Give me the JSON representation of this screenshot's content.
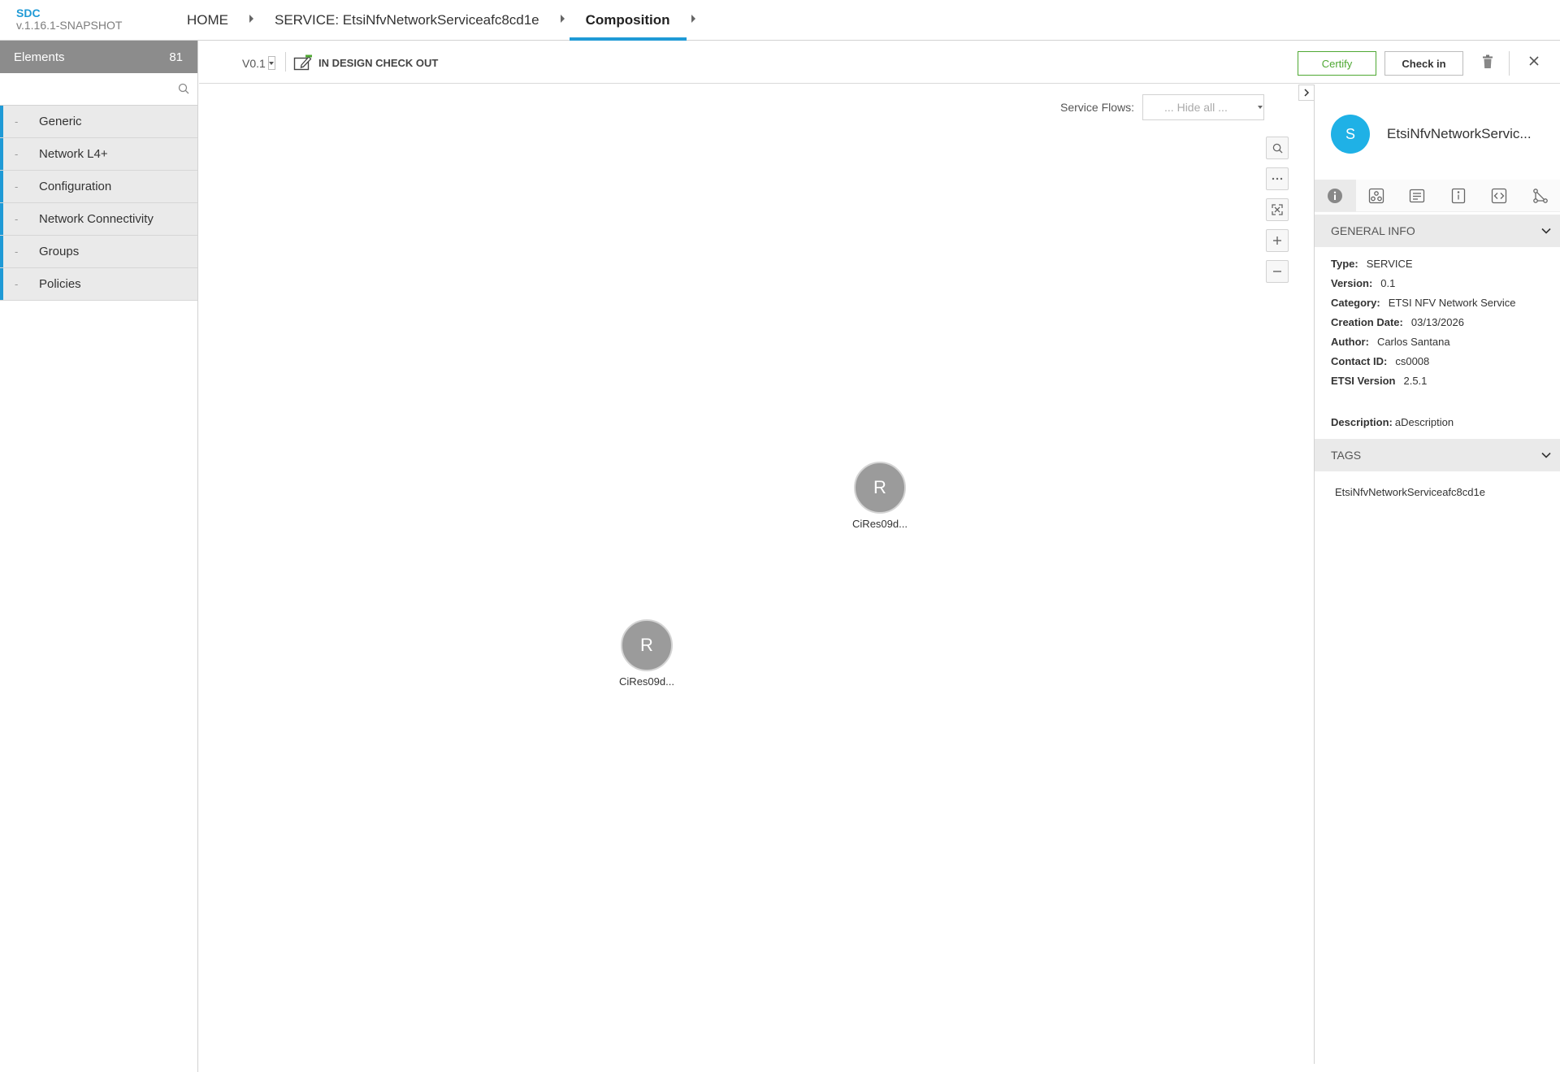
{
  "app": {
    "brand": "SDC",
    "version": "v.1.16.1-SNAPSHOT"
  },
  "breadcrumbs": [
    {
      "label": "HOME"
    },
    {
      "label": "SERVICE: EtsiNfvNetworkServiceafc8cd1e"
    },
    {
      "label": "Composition"
    }
  ],
  "palette": {
    "title": "Elements",
    "count": "81",
    "search_placeholder": "",
    "categories": [
      {
        "dash": "-",
        "label": "Generic"
      },
      {
        "dash": "-",
        "label": "Network L4+"
      },
      {
        "dash": "-",
        "label": "Configuration"
      },
      {
        "dash": "-",
        "label": "Network Connectivity"
      },
      {
        "dash": "-",
        "label": "Groups"
      },
      {
        "dash": "-",
        "label": "Policies"
      }
    ]
  },
  "toolbar": {
    "version": "V0.1",
    "status": "IN DESIGN CHECK OUT",
    "certify_label": "Certify",
    "checkin_label": "Check in"
  },
  "canvas": {
    "service_flows_label": "Service Flows:",
    "service_flows_value": "... Hide all ...",
    "nodes": [
      {
        "letter": "R",
        "label": "CiRes09d..."
      },
      {
        "letter": "R",
        "label": "CiRes09d..."
      }
    ]
  },
  "right_panel": {
    "avatar": "S",
    "title": "EtsiNfvNetworkServic...",
    "tabs": [
      "info-icon",
      "composition-icon",
      "deployment-artifacts-icon",
      "information-artifacts-icon",
      "api-icon",
      "relations-icon"
    ],
    "general_info": {
      "title": "GENERAL INFO",
      "type_k": "Type:",
      "type_v": "SERVICE",
      "version_k": "Version:",
      "version_v": "0.1",
      "category_k": "Category:",
      "category_v": "ETSI NFV Network Service",
      "created_k": "Creation Date:",
      "created_v": "03/13/2026",
      "author_k": "Author:",
      "author_v": "Carlos Santana",
      "contact_k": "Contact ID:",
      "contact_v": "cs0008",
      "etsi_k": "ETSI Version",
      "etsi_v": "2.5.1",
      "desc_k": "Description:",
      "desc_v": "aDescription"
    },
    "tags": {
      "title": "TAGS",
      "values": [
        "EtsiNfvNetworkServiceafc8cd1e"
      ]
    }
  },
  "colors": {
    "accent": "#1f9ad6",
    "certify": "#4fa833",
    "avatar": "#1fb1e6",
    "node": "#9b9b9b"
  }
}
